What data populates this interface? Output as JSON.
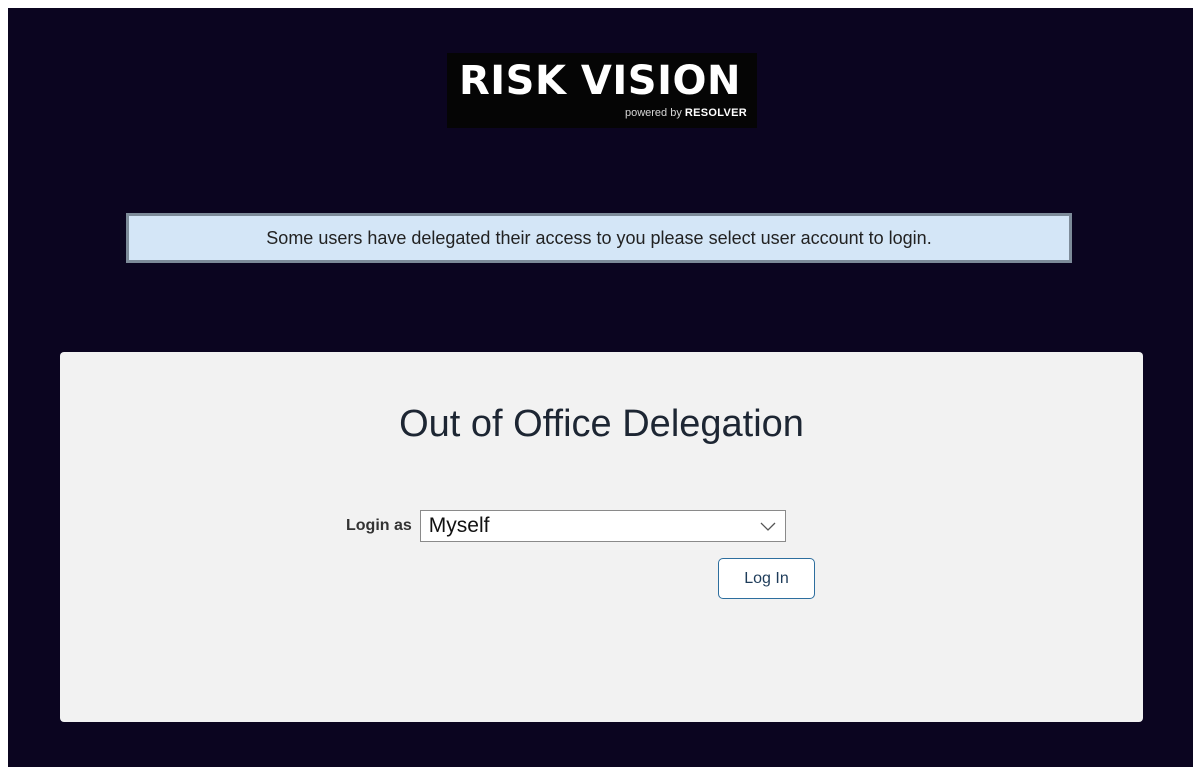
{
  "logo": {
    "title": "RISK VISION",
    "powered_by": "powered by",
    "brand": "RESOLVER"
  },
  "notice": {
    "message": "Some users have delegated their access to you please select user account to login."
  },
  "panel": {
    "title": "Out of Office Delegation",
    "login_label": "Login as",
    "selected_account": "Myself",
    "login_button": "Log In"
  },
  "icons": {
    "dropdown": "chevron-down-icon"
  },
  "colors": {
    "page_background": "#0b0520",
    "notice_background": "#d4e6f7",
    "notice_border": "#7d8b99",
    "panel_background": "#f2f2f2",
    "button_border": "#2d6e9e"
  }
}
